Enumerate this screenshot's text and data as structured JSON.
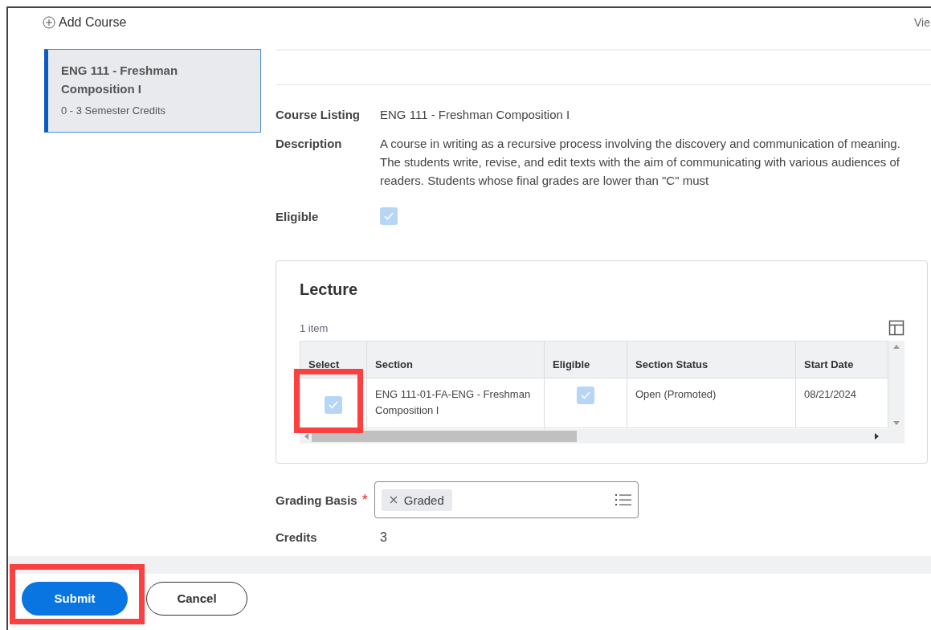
{
  "top_bar": {
    "add_link": "Add Course",
    "view_link": "Vie"
  },
  "courses": [
    {
      "title": "ENG 111 - Freshman Composition I",
      "credits": "0 - 3 Semester Credits",
      "selected": true
    }
  ],
  "details": [
    {
      "label": "Course Listing",
      "value": "ENG 111 - Freshman Composition I",
      "kind": "text"
    },
    {
      "label": "Description",
      "value": "A course in writing as a recursive process involving the discovery and communication of meaning. The students write, revise, and edit texts with the aim of communicating with various audiences of readers. Students whose final grades are lower than \"C\" must",
      "kind": "text"
    },
    {
      "label": "Eligible",
      "checked": true,
      "kind": "checkbox"
    }
  ],
  "lecture": {
    "title": "Lecture",
    "count": "1 item",
    "columns": [
      "Select",
      "Section",
      "Eligible",
      "Section Status",
      "Start Date"
    ],
    "rows": [
      {
        "select": {
          "checked": true,
          "highlighted": true
        },
        "section": "ENG 111-01-FA-ENG - Freshman Composition I",
        "eligible": {
          "checked": true
        },
        "status": "Open (Promoted)",
        "start_date": "08/21/2024"
      }
    ]
  },
  "grading_basis": {
    "label": "Grading Basis",
    "required": true,
    "required_mark": "*",
    "tags": [
      "Graded"
    ]
  },
  "credits": {
    "label": "Credits",
    "value": "3"
  },
  "buttons": [
    {
      "label": "Submit",
      "kind": "primary",
      "highlighted": true
    },
    {
      "label": "Cancel",
      "kind": "secondary",
      "highlighted": false
    }
  ]
}
